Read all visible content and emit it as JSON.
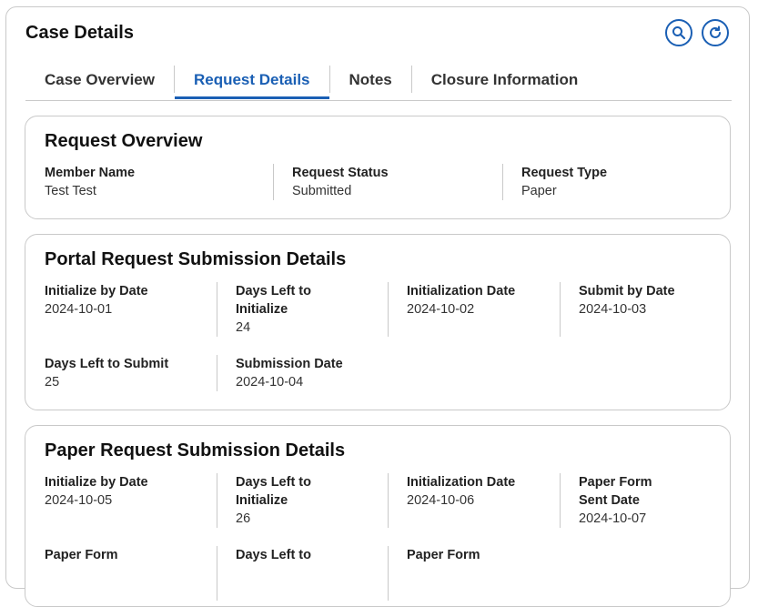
{
  "header": {
    "title": "Case Details",
    "search_icon": "search-icon",
    "refresh_icon": "refresh-icon"
  },
  "tabs": [
    {
      "label": "Case Overview",
      "active": false
    },
    {
      "label": "Request Details",
      "active": true
    },
    {
      "label": "Notes",
      "active": false
    },
    {
      "label": "Closure Information",
      "active": false
    }
  ],
  "request_overview": {
    "title": "Request Overview",
    "fields": [
      {
        "label": "Member Name",
        "value": "Test Test"
      },
      {
        "label": "Request Status",
        "value": "Submitted"
      },
      {
        "label": "Request Type",
        "value": "Paper"
      }
    ]
  },
  "portal": {
    "title": "Portal Request Submission Details",
    "fields": [
      {
        "label": "Initialize by Date",
        "value": "2024-10-01"
      },
      {
        "label": "Days Left to Initialize",
        "value": "24"
      },
      {
        "label": "Initialization Date",
        "value": "2024-10-02"
      },
      {
        "label": "Submit by Date",
        "value": "2024-10-03"
      },
      {
        "label": "Days Left to Submit",
        "value": "25"
      },
      {
        "label": "Submission Date",
        "value": "2024-10-04"
      }
    ]
  },
  "paper": {
    "title": "Paper Request Submission Details",
    "fields": [
      {
        "label": "Initialize by Date",
        "value": "2024-10-05"
      },
      {
        "label": "Days Left to Initialize",
        "value": "26"
      },
      {
        "label": "Initialization Date",
        "value": "2024-10-06"
      },
      {
        "label": "Paper Form Sent Date",
        "value": "2024-10-07"
      },
      {
        "label": "Paper Form",
        "value": ""
      },
      {
        "label": "Days Left to",
        "value": ""
      },
      {
        "label": "Paper Form",
        "value": ""
      }
    ]
  },
  "colors": {
    "accent": "#1a5fb4",
    "border": "#c9c9c9"
  }
}
